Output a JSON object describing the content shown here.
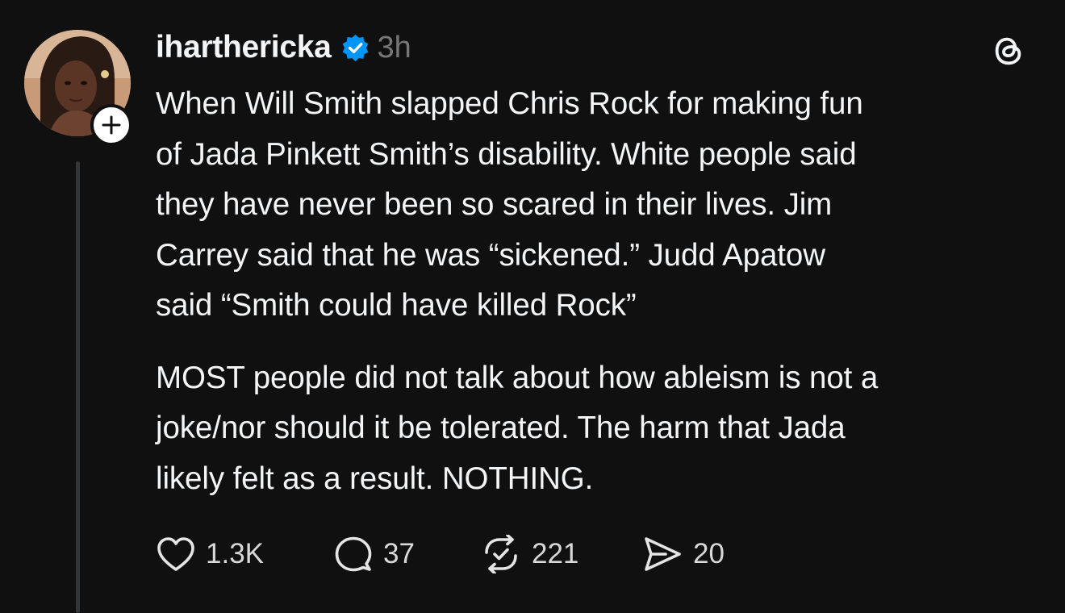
{
  "post": {
    "author": {
      "username": "iharthericka",
      "verified": true,
      "avatar_icon": "user-avatar-photo",
      "follow_icon": "plus-icon"
    },
    "timestamp": "3h",
    "app_icon": "threads-logo-icon",
    "paragraphs": [
      "When Will Smith slapped Chris Rock for making fun\nof Jada Pinkett Smith’s disability. White people said\nthey have never been so scared in their lives. Jim\nCarrey said that he was “sickened.” Judd Apatow\nsaid “Smith could have killed Rock”",
      "MOST people did not talk about how ableism is not a\njoke/nor should it be tolerated. The harm that Jada\nlikely felt as a result. NOTHING."
    ],
    "actions": {
      "likes": "1.3K",
      "replies": "37",
      "reposts": "221",
      "shares": "20"
    }
  },
  "colors": {
    "background": "#101010",
    "text": "#f3f5f7",
    "muted": "#777777",
    "verified_blue": "#0095f6",
    "thread_line": "#333638"
  }
}
